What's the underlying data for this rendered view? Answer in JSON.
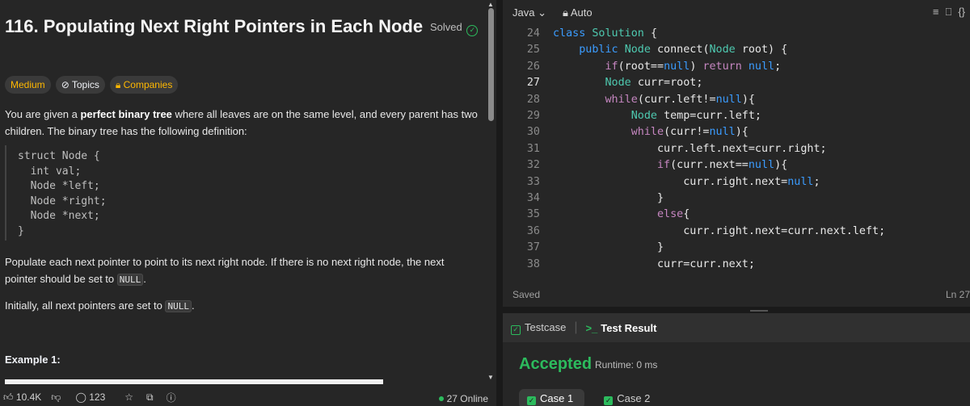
{
  "problem": {
    "title": "116. Populating Next Right Pointers in Each Node",
    "status": "Solved",
    "tags": {
      "difficulty": "Medium",
      "topics": "Topics",
      "companies": "Companies"
    },
    "para1_a": "You are given a ",
    "para1_b": "perfect binary tree",
    "para1_c": " where all leaves are on the same level, and every parent has two",
    "para1_d": "children. The binary tree has the following definition:",
    "struct_code": "struct Node {\n  int val;\n  Node *left;\n  Node *right;\n  Node *next;\n}",
    "para2_a": "Populate each next pointer to point to its next right node. If there is no next right node, the next",
    "para2_b": "pointer should be set to ",
    "null_text": "NULL",
    "para2_c": ".",
    "para3_a": "Initially, all next pointers are set to ",
    "para3_c": ".",
    "example_heading": "Example 1:"
  },
  "footer": {
    "likes": "10.4K",
    "comments": "123",
    "online": "27 Online"
  },
  "editor": {
    "language": "Java",
    "mode": "Auto",
    "saved": "Saved",
    "cursor": "Ln 27",
    "current_line": 27,
    "lines": [
      {
        "n": "24",
        "html": "<span class='kw'>class</span> <span class='cl'>Solution</span> <span class='pl'>{</span>"
      },
      {
        "n": "25",
        "html": "    <span class='kw'>public</span> <span class='cl'>Node</span> <span class='fn'>connect</span><span class='pl'>(</span><span class='cl'>Node</span> <span class='pl'>root) {</span>"
      },
      {
        "n": "26",
        "html": "        <span class='kwp'>if</span><span class='pl'>(root==</span><span class='nl'>null</span><span class='pl'>) </span><span class='kwp'>return</span> <span class='nl'>null</span><span class='pl'>;</span>"
      },
      {
        "n": "27",
        "html": "        <span class='cl'>Node</span> <span class='pl'>curr=root;</span>"
      },
      {
        "n": "28",
        "html": "        <span class='kwp'>while</span><span class='pl'>(curr.left!=</span><span class='nl'>null</span><span class='pl'>){</span>"
      },
      {
        "n": "29",
        "html": "            <span class='cl'>Node</span> <span class='pl'>temp=curr.left;</span>"
      },
      {
        "n": "30",
        "html": "            <span class='kwp'>while</span><span class='pl'>(curr!=</span><span class='nl'>null</span><span class='pl'>){</span>"
      },
      {
        "n": "31",
        "html": "                <span class='pl'>curr.left.next=curr.right;</span>"
      },
      {
        "n": "32",
        "html": "                <span class='kwp'>if</span><span class='pl'>(curr.next==</span><span class='nl'>null</span><span class='pl'>){</span>"
      },
      {
        "n": "33",
        "html": "                    <span class='pl'>curr.right.next=</span><span class='nl'>null</span><span class='pl'>;</span>"
      },
      {
        "n": "34",
        "html": "                <span class='pl'>}</span>"
      },
      {
        "n": "35",
        "html": "                <span class='kwp'>else</span><span class='pl'>{</span>"
      },
      {
        "n": "36",
        "html": "                    <span class='pl'>curr.right.next=curr.next.left;</span>"
      },
      {
        "n": "37",
        "html": "                <span class='pl'>}</span>"
      },
      {
        "n": "38",
        "html": "                <span class='pl'>curr=curr.next;</span>"
      }
    ]
  },
  "test": {
    "tab_testcase": "Testcase",
    "tab_result": "Test Result",
    "verdict": "Accepted",
    "runtime": "Runtime: 0 ms",
    "cases": [
      "Case 1",
      "Case 2"
    ]
  },
  "colors": {
    "accepted": "#2cbb5d",
    "medium": "#ffb800",
    "keyword": "#3b9cff"
  }
}
